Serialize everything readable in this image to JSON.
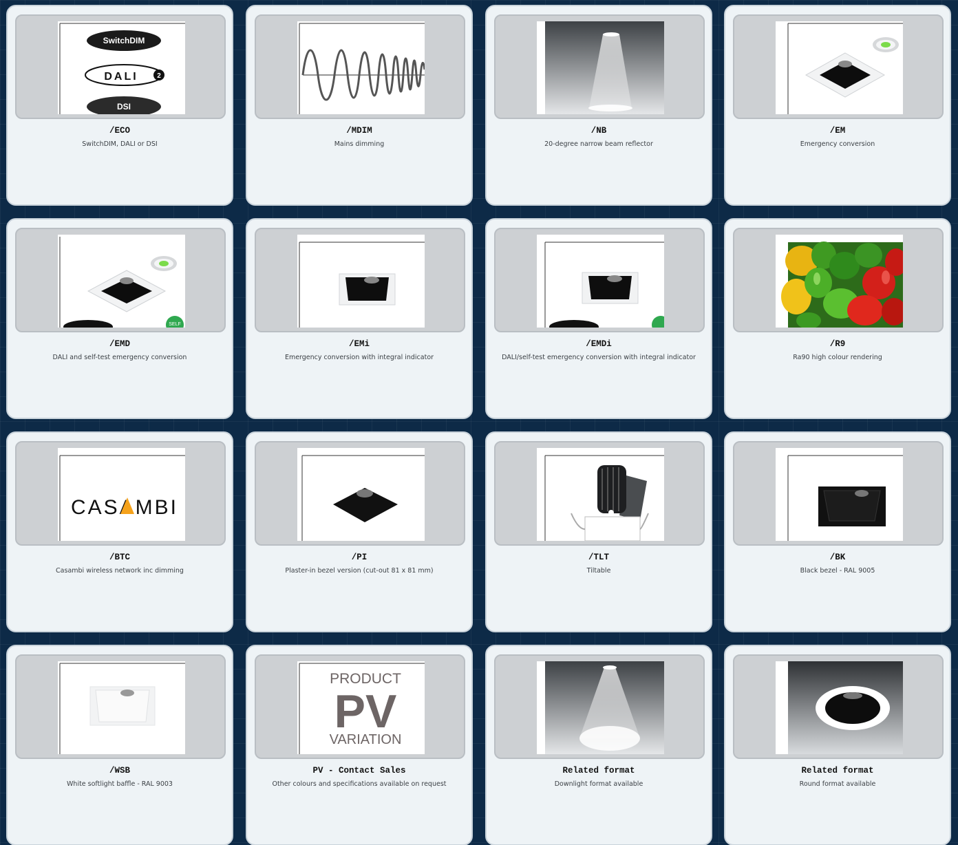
{
  "options": [
    {
      "code": "/ECO",
      "desc": "SwitchDIM, DALI or DSI",
      "icon": "eco-dimming-logos",
      "labels": [
        "SwitchDIM",
        "DALI",
        "DSI"
      ]
    },
    {
      "code": "/MDIM",
      "desc": "Mains dimming",
      "icon": "mains-wave"
    },
    {
      "code": "/NB",
      "desc": "20-degree narrow beam reflector",
      "icon": "narrow-beam"
    },
    {
      "code": "/EM",
      "desc": "Emergency conversion",
      "icon": "emergency-downlight"
    },
    {
      "code": "/EMD",
      "desc": "DALI and self-test emergency conversion",
      "icon": "emergency-dali-downlight"
    },
    {
      "code": "/EMi",
      "desc": "Emergency conversion with integral indicator",
      "icon": "square-downlight"
    },
    {
      "code": "/EMDi",
      "desc": "DALI/self-test emergency conversion with integral indicator",
      "icon": "square-downlight-dali"
    },
    {
      "code": "/R9",
      "desc": "Ra90 high colour rendering",
      "icon": "peppers-photo"
    },
    {
      "code": "/BTC",
      "desc": "Casambi wireless network inc dimming",
      "icon": "casambi-logo",
      "labels": [
        "CASAMBI"
      ]
    },
    {
      "code": "/PI",
      "desc": "Plaster-in bezel version (cut-out 81 x 81 mm)",
      "icon": "plaster-in-diamond"
    },
    {
      "code": "/TLT",
      "desc": "Tiltable",
      "icon": "tiltable-downlight"
    },
    {
      "code": "/BK",
      "desc": "Black bezel - RAL 9005",
      "icon": "black-bezel"
    },
    {
      "code": "/WSB",
      "desc": "White softlight baffle - RAL 9003",
      "icon": "white-baffle"
    },
    {
      "code": "PV - Contact Sales",
      "desc": "Other colours and specifications available on request",
      "icon": "product-variation-logo",
      "labels": [
        "PRODUCT",
        "PV",
        "VARIATION"
      ]
    },
    {
      "code": "Related format",
      "desc": "Downlight format available",
      "icon": "wide-beam"
    },
    {
      "code": "Related format",
      "desc": "Round format available",
      "icon": "round-downlight"
    }
  ],
  "colors": {
    "page_background": "#0d2a47",
    "card_background": "#eef3f6",
    "thumb_frame": "#cdd0d3",
    "text_dark": "#111111",
    "casambi_accent": "#f5a21b",
    "self_test_green": "#2fa84f"
  }
}
